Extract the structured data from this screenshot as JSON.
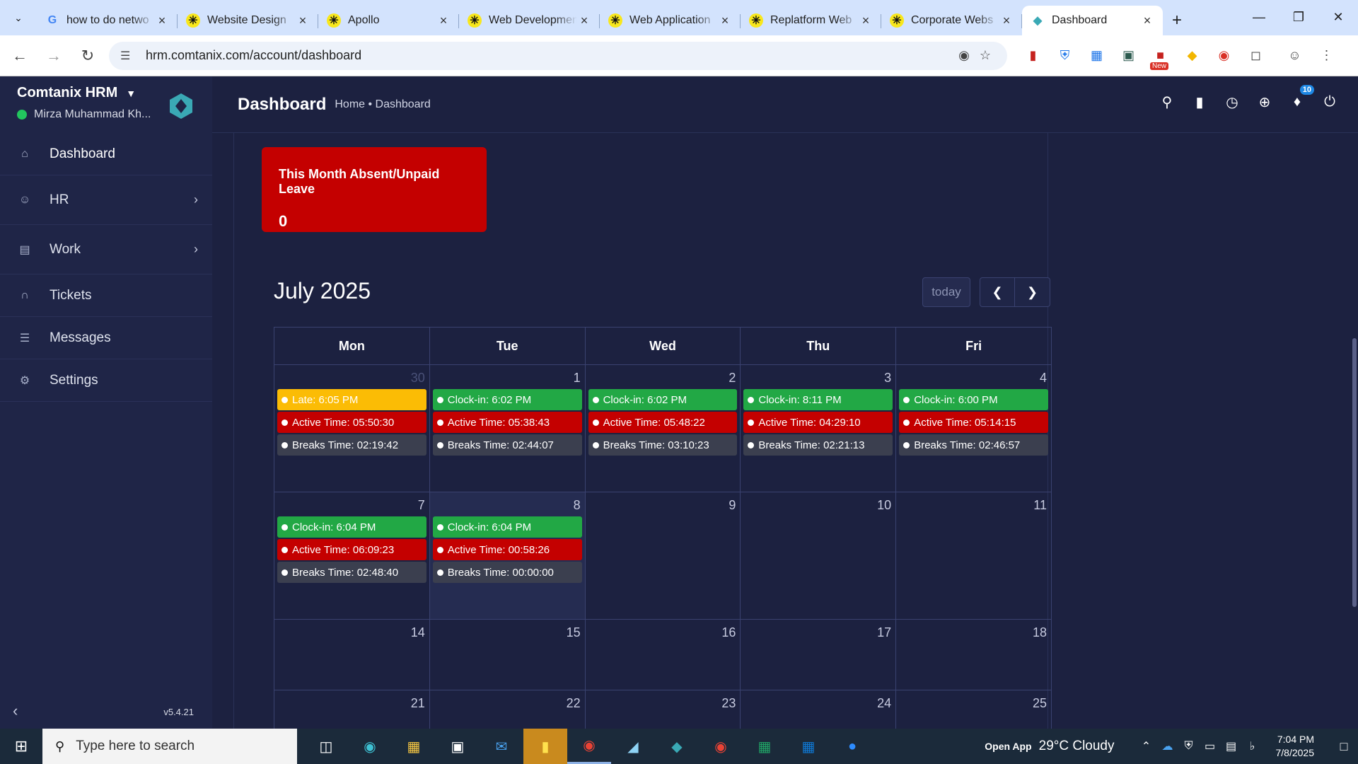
{
  "browser": {
    "tabs": [
      {
        "title": "how to do netwo",
        "favicon": "google-icon",
        "active": false
      },
      {
        "title": "Website Design",
        "favicon": "asterisk-icon",
        "active": false
      },
      {
        "title": "Apollo",
        "favicon": "asterisk-icon",
        "active": false
      },
      {
        "title": "Web Development",
        "favicon": "asterisk-icon",
        "active": false
      },
      {
        "title": "Web Application",
        "favicon": "asterisk-icon",
        "active": false
      },
      {
        "title": "Replatform Web",
        "favicon": "asterisk-icon",
        "active": false
      },
      {
        "title": "Corporate Webs",
        "favicon": "asterisk-icon",
        "active": false
      },
      {
        "title": "Dashboard",
        "favicon": "comtanix-icon",
        "active": true
      }
    ],
    "url": "hrm.comtanix.com/account/dashboard",
    "ext_new_badge": "New"
  },
  "sidebar": {
    "brand": "Comtanix HRM",
    "user": "Mirza Muhammad Kh...",
    "items": [
      {
        "label": "Dashboard",
        "icon": "home-icon"
      },
      {
        "label": "HR",
        "icon": "users-icon"
      },
      {
        "label": "Work",
        "icon": "briefcase-icon"
      },
      {
        "label": "Tickets",
        "icon": "headset-icon"
      },
      {
        "label": "Messages",
        "icon": "message-icon"
      },
      {
        "label": "Settings",
        "icon": "gear-icon"
      }
    ],
    "version": "v5.4.21"
  },
  "header": {
    "title": "Dashboard",
    "breadcrumb": "Home • Dashboard",
    "notification_count": "10"
  },
  "leave_card": {
    "title": "This Month Absent/Unpaid Leave",
    "value": "0"
  },
  "calendar": {
    "title": "July 2025",
    "today_label": "today",
    "days": [
      "Mon",
      "Tue",
      "Wed",
      "Thu",
      "Fri"
    ],
    "weeks": [
      [
        {
          "date": "30",
          "other": true,
          "events": [
            {
              "type": "late",
              "text": "Late: 6:05 PM"
            },
            {
              "type": "active",
              "text": "Active Time: 05:50:30"
            },
            {
              "type": "breaks",
              "text": "Breaks Time: 02:19:42"
            }
          ]
        },
        {
          "date": "1",
          "events": [
            {
              "type": "clock",
              "text": "Clock-in: 6:02 PM"
            },
            {
              "type": "active",
              "text": "Active Time: 05:38:43"
            },
            {
              "type": "breaks",
              "text": "Breaks Time: 02:44:07"
            }
          ]
        },
        {
          "date": "2",
          "events": [
            {
              "type": "clock",
              "text": "Clock-in: 6:02 PM"
            },
            {
              "type": "active",
              "text": "Active Time: 05:48:22"
            },
            {
              "type": "breaks",
              "text": "Breaks Time: 03:10:23"
            }
          ]
        },
        {
          "date": "3",
          "events": [
            {
              "type": "clock",
              "text": "Clock-in: 8:11 PM"
            },
            {
              "type": "active",
              "text": "Active Time: 04:29:10"
            },
            {
              "type": "breaks",
              "text": "Breaks Time: 02:21:13"
            }
          ]
        },
        {
          "date": "4",
          "events": [
            {
              "type": "clock",
              "text": "Clock-in: 6:00 PM"
            },
            {
              "type": "active",
              "text": "Active Time: 05:14:15"
            },
            {
              "type": "breaks",
              "text": "Breaks Time: 02:46:57"
            }
          ]
        }
      ],
      [
        {
          "date": "7",
          "events": [
            {
              "type": "clock",
              "text": "Clock-in: 6:04 PM"
            },
            {
              "type": "active",
              "text": "Active Time: 06:09:23"
            },
            {
              "type": "breaks",
              "text": "Breaks Time: 02:48:40"
            }
          ]
        },
        {
          "date": "8",
          "today": true,
          "events": [
            {
              "type": "clock",
              "text": "Clock-in: 6:04 PM"
            },
            {
              "type": "active",
              "text": "Active Time: 00:58:26"
            },
            {
              "type": "breaks",
              "text": "Breaks Time: 00:00:00"
            }
          ]
        },
        {
          "date": "9",
          "events": []
        },
        {
          "date": "10",
          "events": []
        },
        {
          "date": "11",
          "events": []
        }
      ],
      [
        {
          "date": "14",
          "events": []
        },
        {
          "date": "15",
          "events": []
        },
        {
          "date": "16",
          "events": []
        },
        {
          "date": "17",
          "events": []
        },
        {
          "date": "18",
          "events": []
        }
      ],
      [
        {
          "date": "21",
          "events": []
        },
        {
          "date": "22",
          "events": []
        },
        {
          "date": "23",
          "events": []
        },
        {
          "date": "24",
          "events": []
        },
        {
          "date": "25",
          "events": []
        }
      ]
    ]
  },
  "taskbar": {
    "search_placeholder": "Type here to search",
    "open_app": "Open App",
    "weather": "29°C  Cloudy",
    "time": "7:04 PM",
    "date": "7/8/2025"
  },
  "colors": {
    "sidebar_bg": "#1f2547",
    "content_bg": "#1c2140",
    "late": "#fbbc05",
    "clock_in": "#22a845",
    "active_time": "#c40000",
    "breaks_time": "#3b3f4f"
  }
}
